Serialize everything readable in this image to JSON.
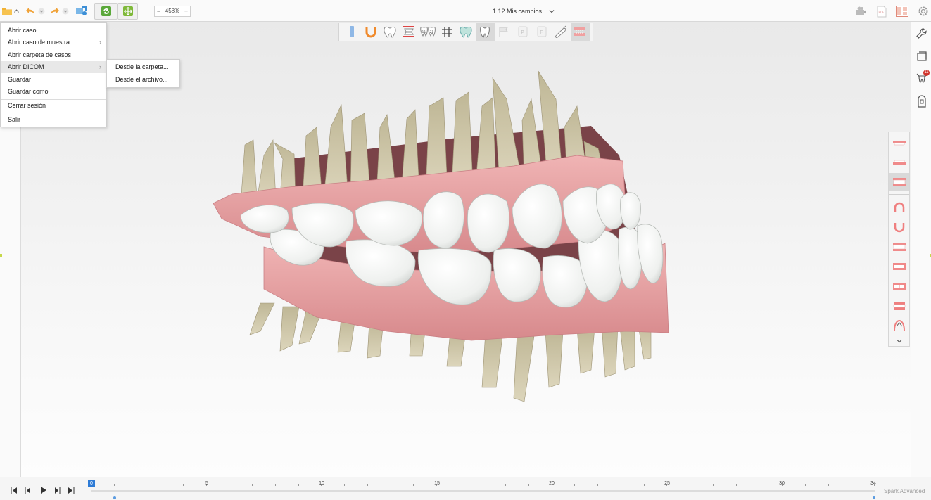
{
  "toolbar": {
    "zoom_minus": "−",
    "zoom_value": "458%",
    "zoom_plus": "+",
    "case_title": "1.12 Mis cambios",
    "case_dropdown": "⌄"
  },
  "menu": {
    "items": [
      {
        "label": "Abrir caso"
      },
      {
        "label": "Abrir caso de muestra",
        "arrow": "›"
      },
      {
        "label": "Abrir carpeta de casos"
      },
      {
        "label": "Abrir DICOM",
        "arrow": "›"
      },
      {
        "label": "Guardar"
      },
      {
        "label": "Guardar como"
      },
      {
        "label": "Cerrar sesión"
      },
      {
        "label": "Salir"
      }
    ],
    "submenu": [
      {
        "label": "Desde la carpeta..."
      },
      {
        "label": "Desde el archivo..."
      }
    ]
  },
  "right_panel": {
    "notification_count": "11"
  },
  "view_tools": {
    "numbering_left": "11",
    "numbering_right": "21",
    "p_label": "P",
    "e_label": "E"
  },
  "timeline": {
    "current": "0",
    "labels": [
      "5",
      "10",
      "15",
      "20",
      "25",
      "30",
      "34"
    ],
    "brand": "Spark Advanced"
  },
  "colors": {
    "accent_green": "#5aa83a",
    "accent_orange": "#f0a33a",
    "accent_blue": "#2d7bd6",
    "gingiva": "#e8a0a0",
    "tooth": "#f4f4f2",
    "root": "#cfc7a8"
  }
}
